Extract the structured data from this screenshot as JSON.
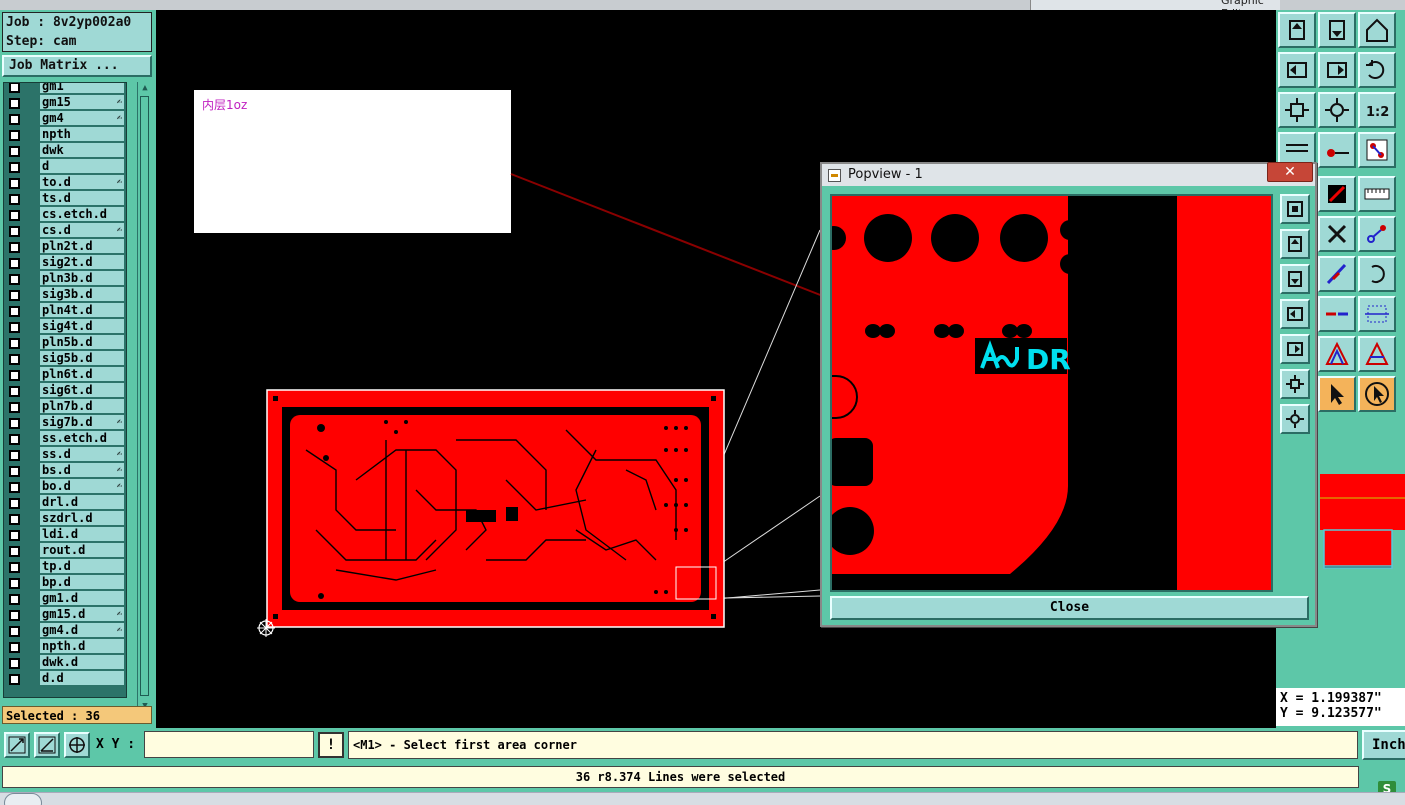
{
  "window": {
    "title_fragment": "Graphic Editor"
  },
  "job": {
    "job_label": "Job : 8v2yp002a0",
    "step_label": "Step: cam"
  },
  "job_matrix_button": "Job Matrix ...",
  "layers": [
    {
      "name": "gm1",
      "flag": ""
    },
    {
      "name": "gm15",
      "flag": "✍"
    },
    {
      "name": "gm4",
      "flag": "✍"
    },
    {
      "name": "npth",
      "flag": ""
    },
    {
      "name": "dwk",
      "flag": ""
    },
    {
      "name": "d",
      "flag": ""
    },
    {
      "name": "to.d",
      "flag": "✍"
    },
    {
      "name": "ts.d",
      "flag": ""
    },
    {
      "name": "cs.etch.d",
      "flag": ""
    },
    {
      "name": "cs.d",
      "flag": "✍"
    },
    {
      "name": "pln2t.d",
      "flag": ""
    },
    {
      "name": "sig2t.d",
      "flag": ""
    },
    {
      "name": "pln3b.d",
      "flag": ""
    },
    {
      "name": "sig3b.d",
      "flag": ""
    },
    {
      "name": "pln4t.d",
      "flag": ""
    },
    {
      "name": "sig4t.d",
      "flag": ""
    },
    {
      "name": "pln5b.d",
      "flag": ""
    },
    {
      "name": "sig5b.d",
      "flag": ""
    },
    {
      "name": "pln6t.d",
      "flag": ""
    },
    {
      "name": "sig6t.d",
      "flag": ""
    },
    {
      "name": "pln7b.d",
      "flag": ""
    },
    {
      "name": "sig7b.d",
      "flag": "✍"
    },
    {
      "name": "ss.etch.d",
      "flag": ""
    },
    {
      "name": "ss.d",
      "flag": "✍"
    },
    {
      "name": "bs.d",
      "flag": "✍"
    },
    {
      "name": "bo.d",
      "flag": "✍"
    },
    {
      "name": "drl.d",
      "flag": ""
    },
    {
      "name": "szdrl.d",
      "flag": ""
    },
    {
      "name": "ldi.d",
      "flag": ""
    },
    {
      "name": "rout.d",
      "flag": ""
    },
    {
      "name": "tp.d",
      "flag": ""
    },
    {
      "name": "bp.d",
      "flag": ""
    },
    {
      "name": "gm1.d",
      "flag": ""
    },
    {
      "name": "gm15.d",
      "flag": "✍"
    },
    {
      "name": "gm4.d",
      "flag": "✍"
    },
    {
      "name": "npth.d",
      "flag": ""
    },
    {
      "name": "dwk.d",
      "flag": ""
    },
    {
      "name": "d.d",
      "flag": ""
    }
  ],
  "selected_label": "Selected : 36",
  "note_text": "内层1oz",
  "popview": {
    "title": "Popview - 1",
    "close_x": "✕",
    "close_button": "Close",
    "marking_text": "DR"
  },
  "coordinates": {
    "x": "X = 1.199387\"",
    "y": "Y = 9.123577\""
  },
  "command": {
    "xy_label": "X Y :",
    "xy_value": "",
    "warn_label": "!",
    "prompt": "<M1> - Select first area corner",
    "units": "Inch"
  },
  "status": {
    "message": "36 r8.374 Lines were selected",
    "tray_icon": "S"
  },
  "colors": {
    "panel": "#5dc7a8",
    "button": "#9fd9d5",
    "copper": "#ff0000",
    "highlight": "#00e0f0",
    "selected_bg": "#f4c87a"
  }
}
